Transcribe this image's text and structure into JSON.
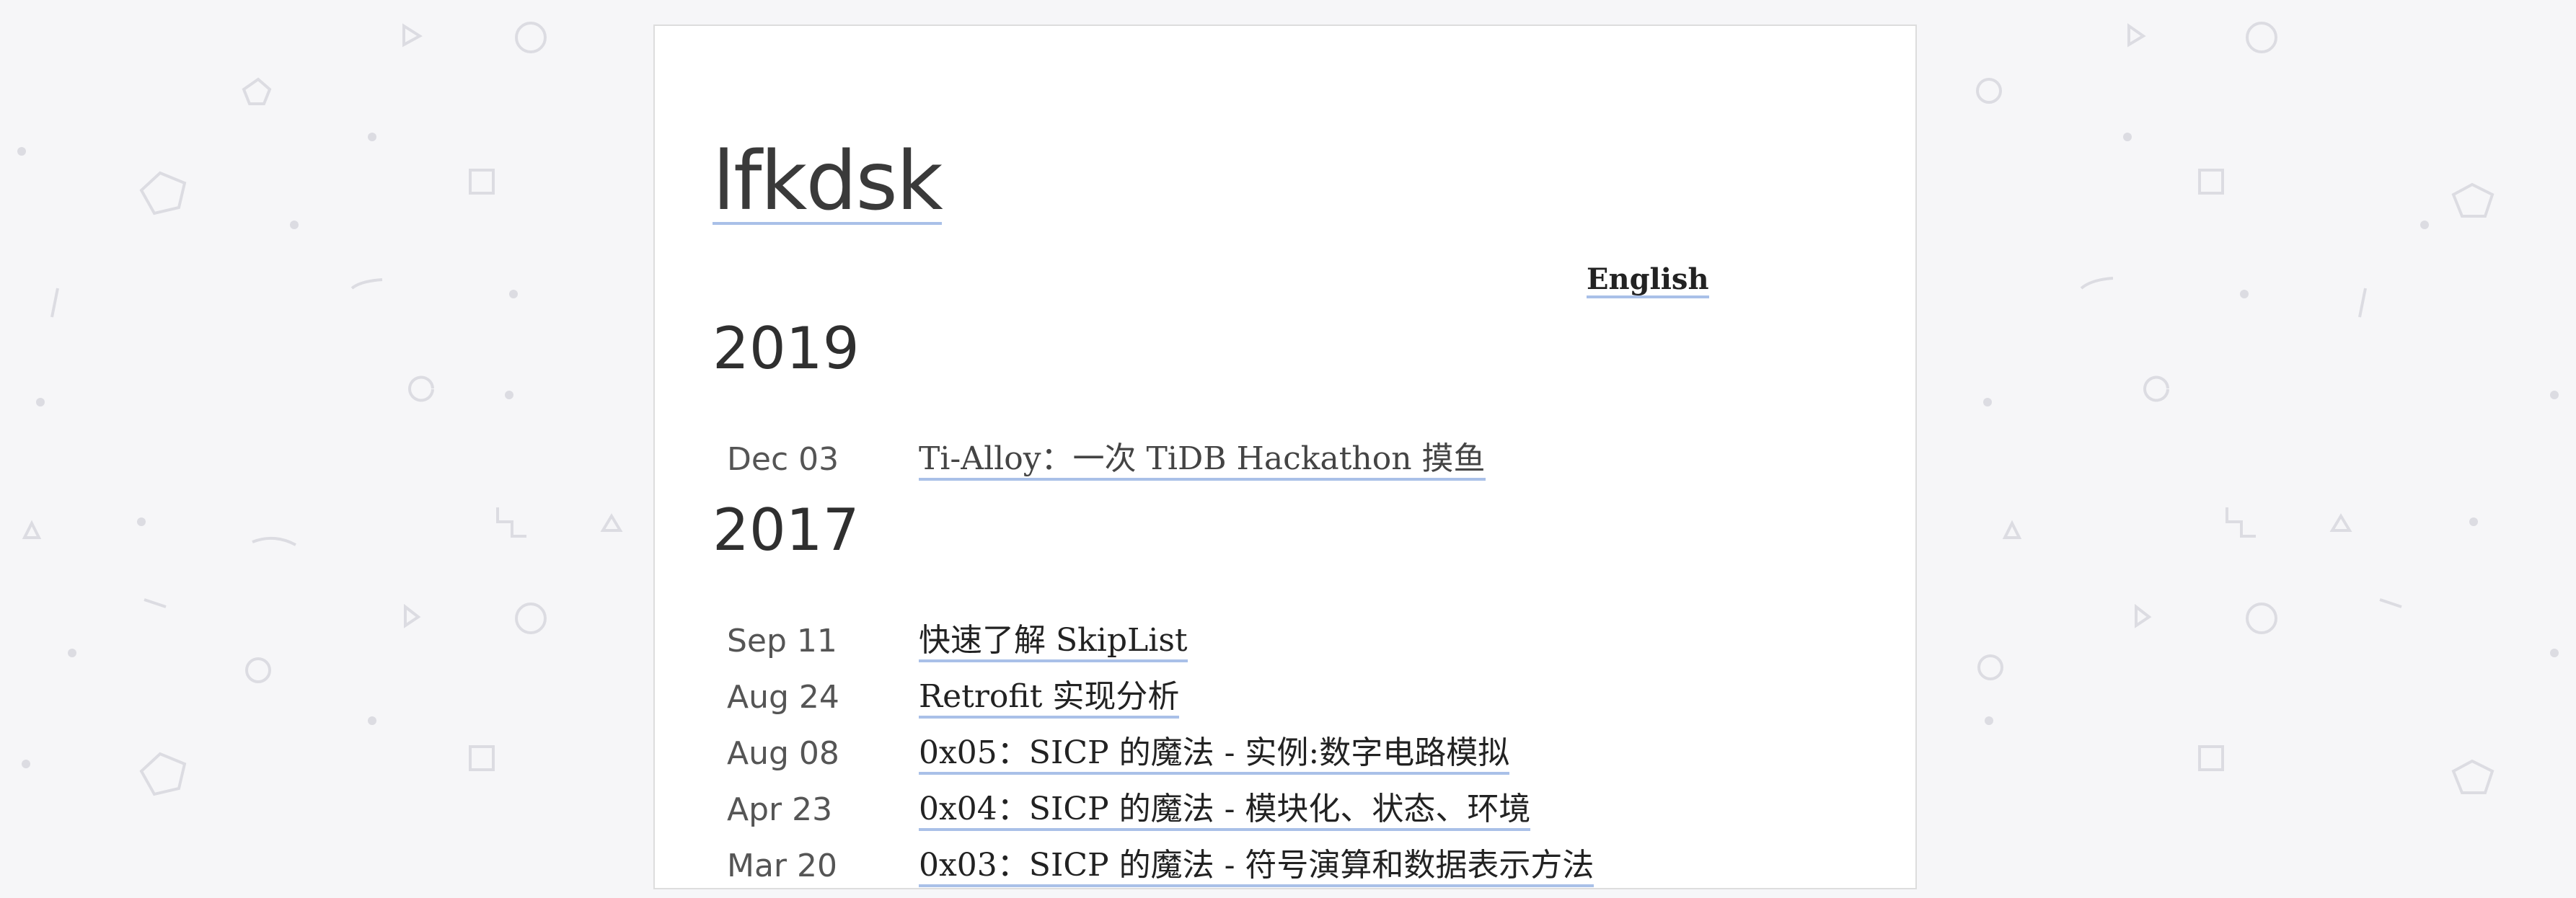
{
  "site": {
    "title": "lfkdsk",
    "language_switch": "English"
  },
  "archive": [
    {
      "year": "2019",
      "posts": [
        {
          "date": "Dec 03",
          "title": "Ti-Alloy：一次 TiDB Hackathon 摸鱼"
        }
      ]
    },
    {
      "year": "2017",
      "posts": [
        {
          "date": "Sep 11",
          "title": "快速了解 SkipList"
        },
        {
          "date": "Aug 24",
          "title": "Retrofit 实现分析"
        },
        {
          "date": "Aug 08",
          "title": "0x05：SICP 的魔法 - 实例:数字电路模拟"
        },
        {
          "date": "Apr 23",
          "title": "0x04：SICP 的魔法 - 模块化、状态、环境"
        },
        {
          "date": "Mar 20",
          "title": "0x03：SICP 的魔法 - 符号演算和数据表示方法"
        }
      ]
    }
  ],
  "colors": {
    "background": "#f6f6f8",
    "link_underline": "#a9c0e8",
    "pattern": "#dcdce2"
  }
}
